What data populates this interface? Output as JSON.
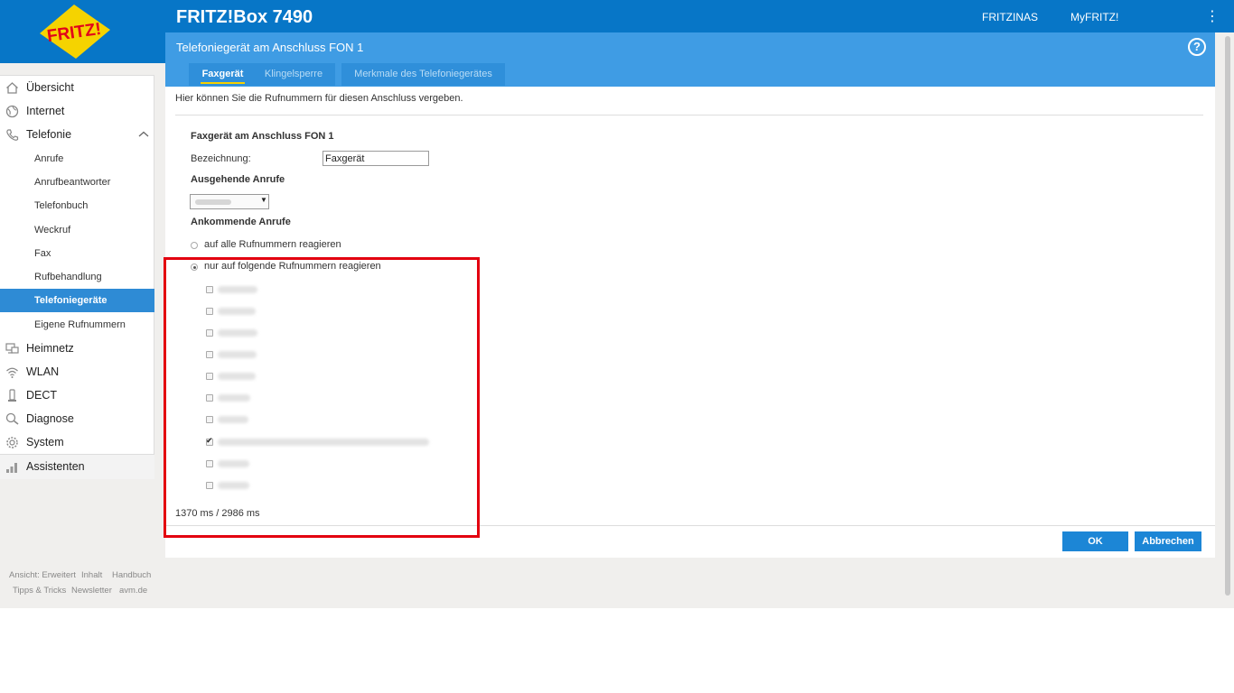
{
  "header": {
    "product": "FRITZ!Box 7490",
    "logo_text": "FRITZ!",
    "links": {
      "fritznas": "FRITZINAS",
      "myfritz": "MyFRITZ!"
    },
    "menu_icon": "⋮",
    "page_title": "Telefoniegerät am Anschluss FON 1",
    "help_icon": "?",
    "tabs": [
      {
        "label": "Faxgerät",
        "active": true
      },
      {
        "label": "Klingelsperre",
        "active": false
      },
      {
        "label": "Merkmale des Telefoniegerätes",
        "active": false
      }
    ]
  },
  "sidebar": {
    "main": [
      {
        "label": "Übersicht",
        "icon": "home-icon"
      },
      {
        "label": "Internet",
        "icon": "globe-icon"
      },
      {
        "label": "Telefonie",
        "icon": "phone-icon",
        "expanded": true
      },
      {
        "label": "Heimnetz",
        "icon": "network-icon"
      },
      {
        "label": "WLAN",
        "icon": "wifi-icon"
      },
      {
        "label": "DECT",
        "icon": "dect-icon"
      },
      {
        "label": "Diagnose",
        "icon": "diagnose-icon"
      },
      {
        "label": "System",
        "icon": "system-icon"
      },
      {
        "label": "Assistenten",
        "icon": "assistant-icon"
      }
    ],
    "sub": [
      {
        "label": "Anrufe"
      },
      {
        "label": "Anrufbeantworter"
      },
      {
        "label": "Telefonbuch"
      },
      {
        "label": "Weckruf"
      },
      {
        "label": "Fax"
      },
      {
        "label": "Rufbehandlung"
      },
      {
        "label": "Telefoniegeräte",
        "active": true
      },
      {
        "label": "Eigene Rufnummern"
      }
    ]
  },
  "footer": {
    "links": [
      "Ansicht: Erweitert",
      "Inhalt",
      "Handbuch",
      "Tipps & Tricks",
      "Newsletter",
      "avm.de"
    ]
  },
  "content": {
    "intro": "Hier können Sie die Rufnummern für diesen Anschluss vergeben.",
    "section_title": "Faxgerät am Anschluss FON 1",
    "name_label": "Bezeichnung:",
    "name_value": "Faxgerät",
    "outgoing_title": "Ausgehende Anrufe",
    "incoming_title": "Ankommende Anrufe",
    "radio_all": "auf alle Rufnummern reagieren",
    "radio_specific": "nur auf folgende Rufnummern reagieren",
    "radio_selected": "specific",
    "numbers_checked": [
      false,
      false,
      false,
      false,
      false,
      false,
      false,
      true,
      false,
      false
    ],
    "timing": "1370 ms / 2986 ms",
    "ok_label": "OK",
    "cancel_label": "Abbrechen"
  },
  "colors": {
    "brand_blue": "#0776c7",
    "header_light_blue": "#3f9ce4",
    "active_nav": "#2e8bd5",
    "button": "#1c86d6",
    "highlight_red": "#e3000f",
    "tab_underline": "#f7d100"
  }
}
